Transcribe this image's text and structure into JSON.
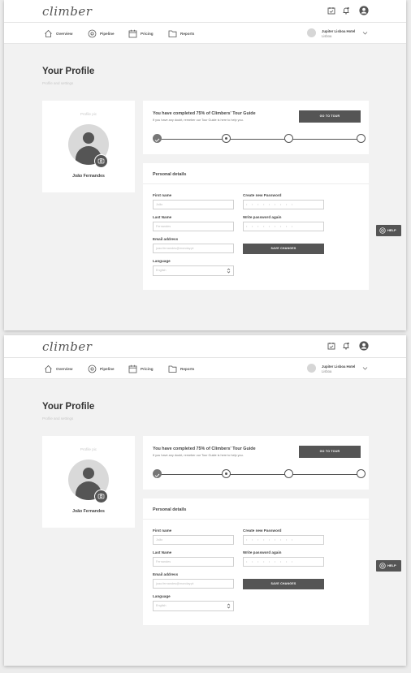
{
  "app": {
    "logo": "climber"
  },
  "nav": {
    "items": [
      {
        "label": "Overview",
        "icon": "house-icon"
      },
      {
        "label": "Pipeline",
        "icon": "pipeline-icon"
      },
      {
        "label": "Pricing",
        "icon": "calendar-icon"
      },
      {
        "label": "Reports",
        "icon": "folder-icon"
      }
    ],
    "hotel": {
      "name": "Jupiter Lisboa Hotel",
      "city": "Lisboa"
    }
  },
  "topbar": {
    "icons": [
      "calendar-check-icon",
      "bell-icon",
      "user-icon"
    ]
  },
  "page": {
    "title": "Your Profile",
    "subtitle": "Profile and settings"
  },
  "profile": {
    "pic_label": "Profile pic",
    "name": "João Fernandes"
  },
  "tour": {
    "title": "You have completed 75% of Climbers' Tour Guide",
    "subtitle": "If you have any doubt, remeber our Tour Guide is here to help you.",
    "button": "GO TO TOUR",
    "progress_percent": 75,
    "steps": [
      "done",
      "current",
      "todo",
      "todo"
    ]
  },
  "details": {
    "title": "Personal details",
    "first_name": {
      "label": "First name",
      "value": "João"
    },
    "last_name": {
      "label": "Last Name",
      "value": "Fernandes"
    },
    "email": {
      "label": "Email address",
      "value": "joao.fernandes@monday.pt"
    },
    "language": {
      "label": "Language",
      "value": "English"
    },
    "new_password": {
      "label": "Create new Password",
      "value": "• • • • • • • • •"
    },
    "repeat_password": {
      "label": "Write password again",
      "value": "• • • • • • • • •"
    },
    "save_button": "SAVE CHANGES"
  },
  "help": {
    "label": "HELP"
  },
  "colors": {
    "accent_dark": "#555555",
    "background": "#f2f2f2",
    "card": "#ffffff"
  }
}
